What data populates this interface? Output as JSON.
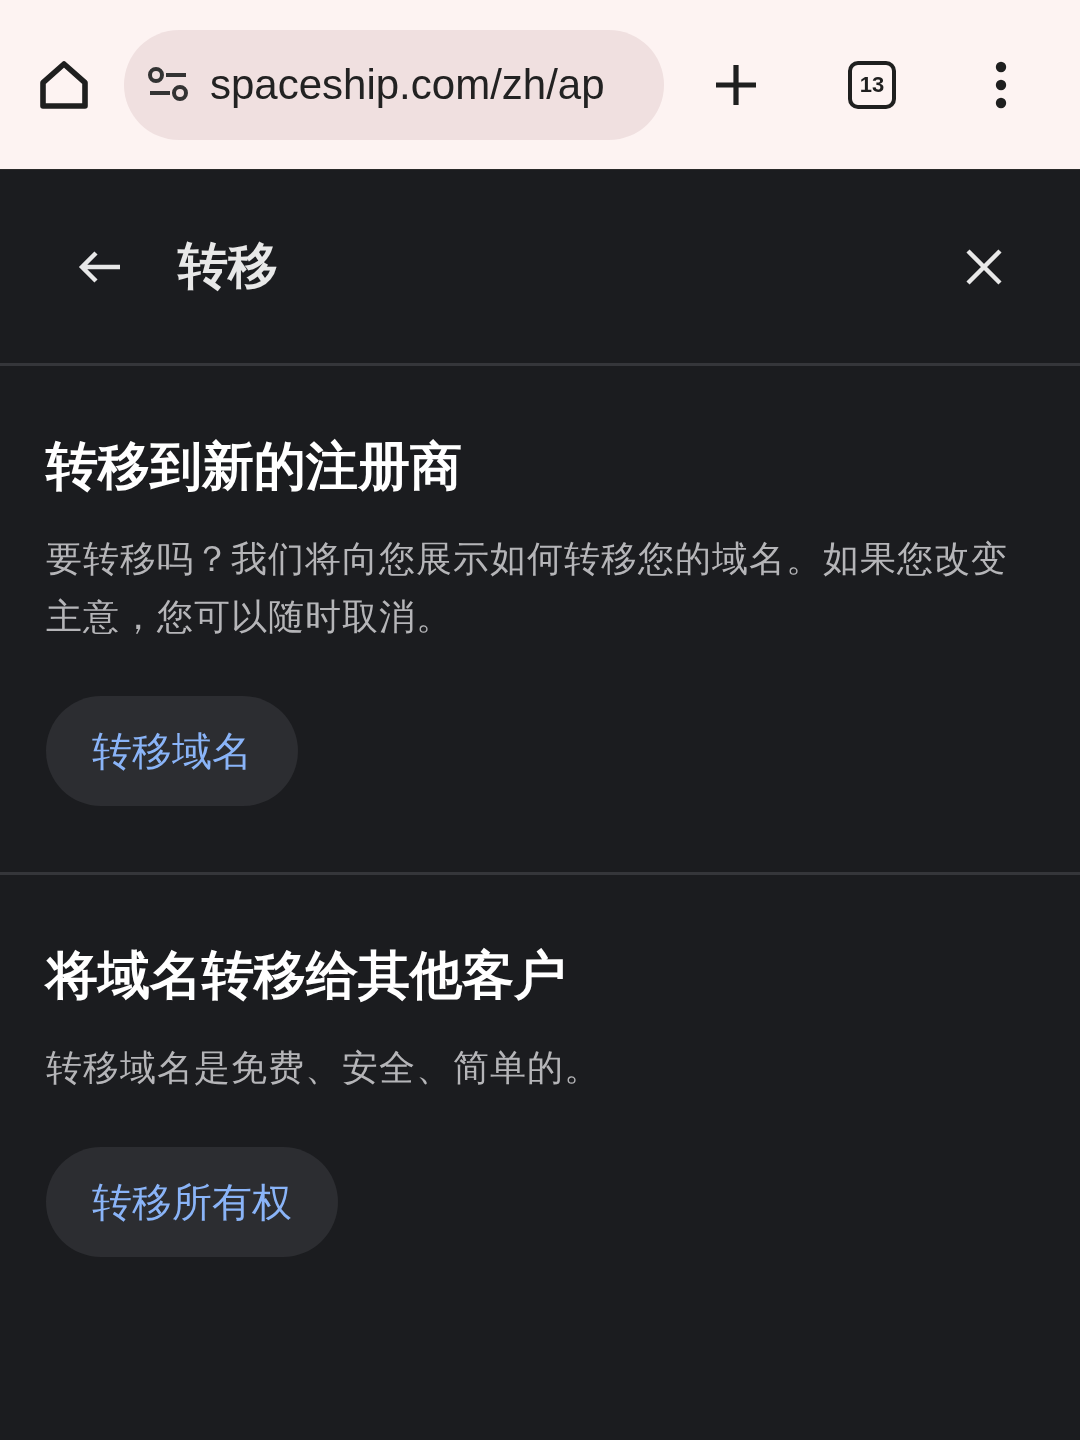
{
  "browser": {
    "url": "spaceship.com/zh/ap",
    "tab_count": "13"
  },
  "header": {
    "title": "转移"
  },
  "sections": [
    {
      "title": "转移到新的注册商",
      "description": "要转移吗？我们将向您展示如何转移您的域名。如果您改变主意，您可以随时取消。",
      "button": "转移域名"
    },
    {
      "title": "将域名转移给其他客户",
      "description": "转移域名是免费、安全、简单的。",
      "button": "转移所有权"
    }
  ]
}
